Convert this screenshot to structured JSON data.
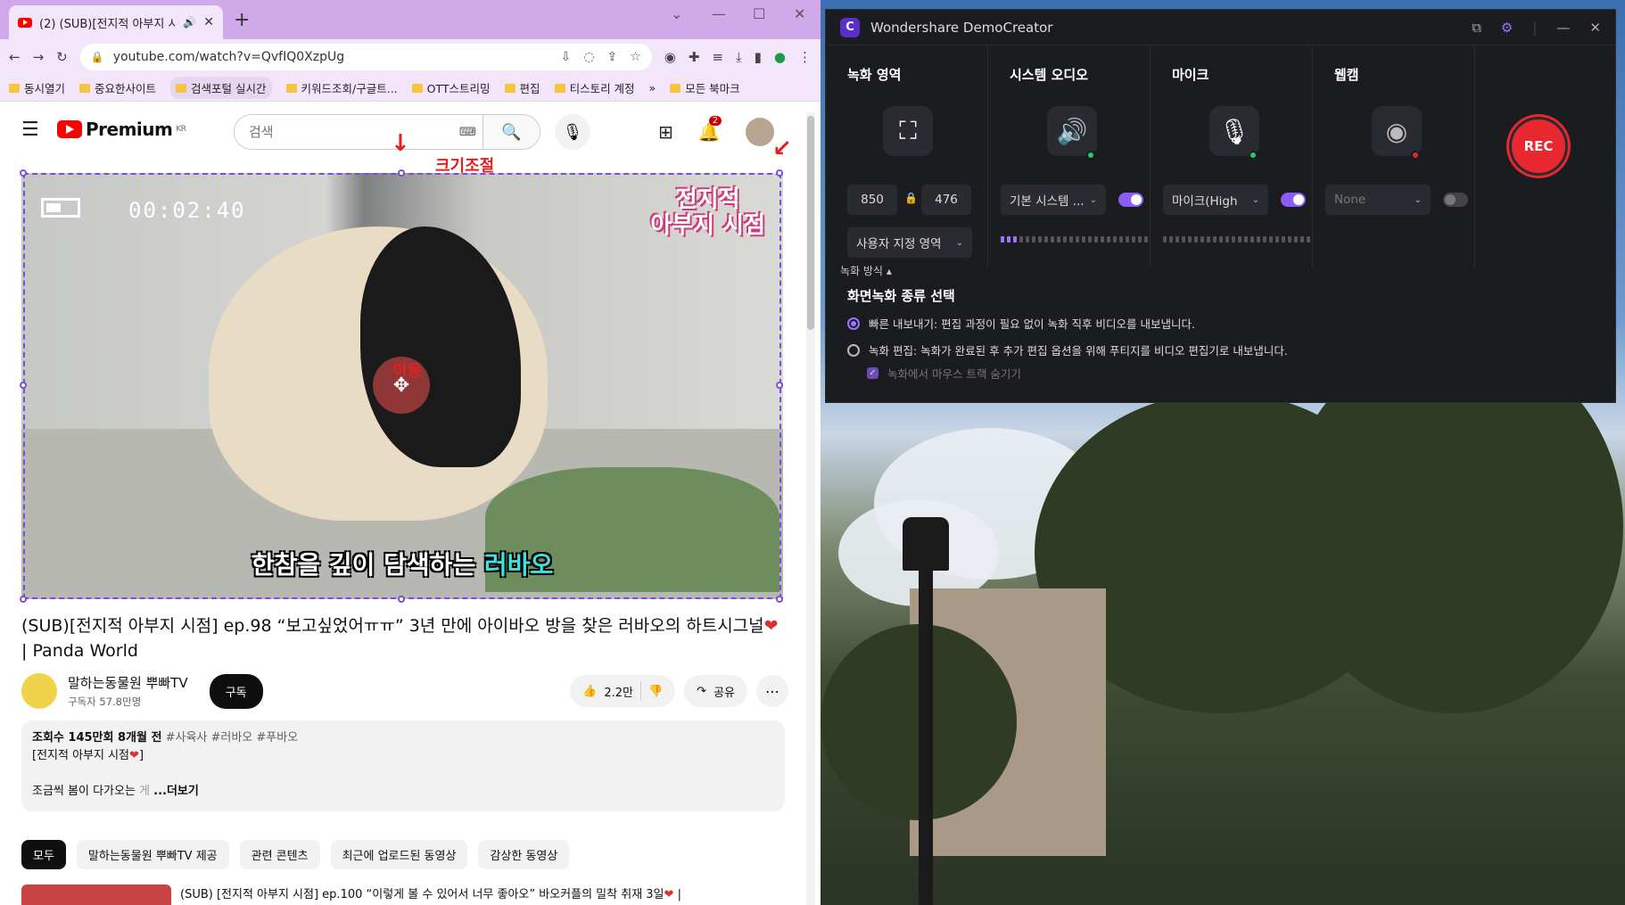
{
  "browser": {
    "tab_title": "(2) (SUB)[전지적 아부지 시점",
    "url": "youtube.com/watch?v=QvfIQ0XzpUg",
    "bookmarks": [
      "동시열기",
      "중요한사이트",
      "검색포털 실시간",
      "키워드조회/구글트...",
      "OTT스트리밍",
      "편집",
      "티스토리 계정",
      "»",
      "모든 북마크"
    ]
  },
  "youtube": {
    "logo_text": "Premium",
    "logo_region": "KR",
    "search_placeholder": "검색",
    "notification_count": "2",
    "video": {
      "timer": "00:02:40",
      "watermark_line1": "전지적",
      "watermark_line2": "아부지 시점",
      "subtitle_main": "한참을 깊이 담색하는",
      "subtitle_name": "러바오"
    },
    "annotations": {
      "resize": "크기조절",
      "move": "이동"
    },
    "title": "(SUB)[전지적 아부지 시점] ep.98 “보고싶었어ㅠㅠ” 3년 만에 아이바오 방을 찾은 러바오의 하트시그널",
    "title_suffix": "| Panda World",
    "channel_name": "말하는동물원 뿌빠TV",
    "channel_subs": "구독자 57.8만명",
    "subscribe": "구독",
    "likes": "2.2만",
    "share": "공유",
    "desc_stats": "조회수 145만회  8개월 전",
    "desc_tags": "#사육사 #러바오 #푸바오",
    "desc_line2": "[전지적 아부지 시점",
    "desc_line3": "조금씩 봄이 다가오는",
    "desc_line3_fade": "게",
    "desc_more": "...더보기",
    "chips": [
      "모두",
      "말하는동물원 뿌빠TV 제공",
      "관련 콘텐츠",
      "최근에 업로드된 동영상",
      "감상한 동영상"
    ],
    "related_title": "(SUB) [전지적 아부지 시점] ep.100 “이렇게 볼 수 있어서 너무 좋아오” 바오커플의 밀착 취재 3일"
  },
  "democreator": {
    "app_title": "Wondershare DemoCreator",
    "area_label": "녹화 영역",
    "width": "850",
    "height": "476",
    "area_preset": "사용자 지정 영역",
    "sys_audio_label": "시스템 오디오",
    "sys_audio_value": "기본 시스템 ...",
    "mic_label": "마이크",
    "mic_value": "마이크(High",
    "webcam_label": "웹캠",
    "webcam_value": "None",
    "rec_button": "REC",
    "mode_toggle": "녹화 방식",
    "mode_heading": "화면녹화 종류 선택",
    "opt_fast": "빠른 내보내기: 편집 과정이 필요 없이 녹화 직후 비디오를 내보냅니다.",
    "opt_edit": "녹화 편집: 녹화가 완료된 후 추가 편집 옵션을 위해 푸티지를 비디오 편집기로 내보냅니다.",
    "opt_hide_mouse": "녹화에서 마우스 트랙 숨기기"
  },
  "colors": {
    "accent": "#8c5cf5",
    "rec_red": "#e9272e",
    "youtube_red": "#ff0000",
    "annotation_red": "#e51f1f"
  }
}
